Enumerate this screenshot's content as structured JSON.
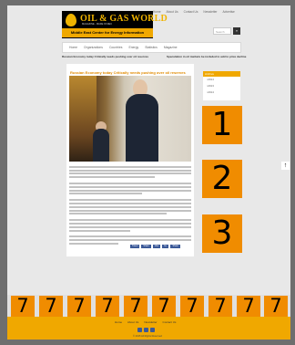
{
  "top_links": [
    "Home",
    "About Us",
    "Contact Us",
    "Newsletter",
    "Advertise"
  ],
  "logo": {
    "title": "OIL & GAS WORLD",
    "tagline": "MAGAZINE - MADE IN MEC",
    "subtitle": "Middle East Center for Energy Information"
  },
  "search": {
    "placeholder": "Search",
    "button": "»"
  },
  "nav": [
    "Home",
    "Organizations",
    "Countries",
    "Energy",
    "Statistics",
    "Magazine"
  ],
  "ticker": [
    "Russian Economy today Critically needs pushing over oil reserves",
    "Speculation in oil markets be included to add to price decline"
  ],
  "article": {
    "title": "Russian Economy today Critically needs pushing over oil reserves"
  },
  "share": [
    "Tweet",
    "Share",
    "Like",
    "G+",
    "Share"
  ],
  "sidebar": {
    "header": "Archive",
    "items": [
      "2014",
      "2013",
      "2014"
    ]
  },
  "side_numbers": [
    "1",
    "2",
    "3"
  ],
  "bottom_numbers": [
    "7",
    "7",
    "7",
    "7",
    "7",
    "7",
    "7",
    "7",
    "7",
    "7"
  ],
  "footer": {
    "links": [
      "Home",
      "About Us",
      "Newsletter",
      "Contact Us"
    ],
    "copyright": "© 2015 All Rights Reserved"
  },
  "colors": {
    "accent": "#f0a800",
    "ad_box": "#f08c00"
  }
}
